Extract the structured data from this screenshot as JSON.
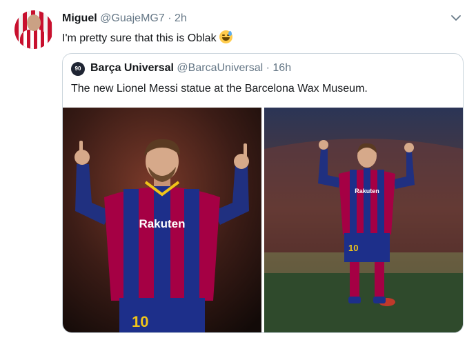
{
  "tweet": {
    "author_name": "Miguel",
    "author_handle": "@GuajeMG7",
    "separator": "·",
    "time": "2h",
    "text": "I'm pretty sure that this is Oblak",
    "emoji": "sweat-smile-emoji",
    "menu_icon": "chevron-down-icon"
  },
  "quote": {
    "avatar_text": "90",
    "author_name": "Barça Universal",
    "author_handle": "@BarcaUniversal",
    "separator": "·",
    "time": "16h",
    "text": "The new Lionel Messi statue at the Barcelona Wax Museum.",
    "photos": [
      {
        "shirt_sponsor": "Rakuten",
        "shirt_number": "10"
      },
      {
        "shirt_sponsor": "Rakuten",
        "shirt_number": "10"
      }
    ]
  },
  "colors": {
    "text": "#14171a",
    "secondary_text": "#657786",
    "border": "#ccd6dd",
    "accent": "#1da1f2",
    "barca_blue": "#1d2f8a",
    "barca_red": "#a50044"
  }
}
